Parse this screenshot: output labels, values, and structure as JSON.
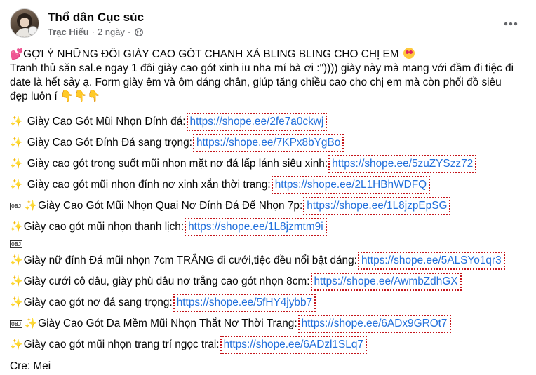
{
  "post": {
    "page_name": "Thổ dân Cục súc",
    "author": "Trạc Hiếu",
    "time": "2 ngày",
    "separator": "·",
    "more_icon": "more-horizontal-icon",
    "intro": {
      "heart_glyph": "💕",
      "headline": "GỢI Ý NHỮNG ĐÔI GIÀY CAO GÓT CHANH XẢ BLING BLING CHO CHỊ EM",
      "line2": "Tranh thủ săn sal.e ngay 1 đôi giày cao gót xinh iu nha mí bà ơi :\")))) giày này mà mang với đầm đi tiệc đi",
      "line3": "date là hết sảy ạ. Form giày êm và ôm dáng chân, giúp tăng chiều cao cho chị em mà còn phối đồ siêu",
      "line4": "đẹp luôn í",
      "hands": "👇👇👇"
    },
    "items": [
      {
        "prefix": "",
        "label": "Giày Cao Gót Mũi Nhọn Đính đá:",
        "link": "https://shope.ee/2fe7a0ckwj"
      },
      {
        "prefix": "",
        "label": "Giày Cao Gót Đính Đá sang trọng:",
        "link": "https://shope.ee/7KPx8bYgBo"
      },
      {
        "prefix": "",
        "label": "Giày cao gót trong suốt mũi nhọn mặt nơ đá lấp lánh siêu xinh:",
        "link": "https://shope.ee/5zuZYSzz72"
      },
      {
        "prefix": "",
        "label": "Giày cao gót mũi nhọn đính nơ xinh xắn thời trang:",
        "link": "https://shope.ee/2L1HBhWDFQ"
      },
      {
        "prefix": "OBJ",
        "label": "Giày Cao Gót Mũi Nhọn Quai Nơ Đính Đá Đế Nhọn 7p:",
        "link": "https://shope.ee/1L8jzpEpSG"
      },
      {
        "prefix": "",
        "label": "Giày cao gót mũi nhọn thanh lịch:",
        "link": "https://shope.ee/1L8jzmtm9i"
      },
      {
        "prefix": "",
        "label": "Giày nữ đính Đá mũi nhọn 7cm TRẮNG đi cưới,tiệc đều nổi bật dáng:",
        "link": "https://shope.ee/5ALSYo1qr3"
      },
      {
        "prefix": "",
        "label": "Giày cưới cô dâu, giày phù dâu nơ trắng cao gót nhọn 8cm:",
        "link": "https://shope.ee/AwmbZdhGX"
      },
      {
        "prefix": "",
        "label": "Giày cao gót nơ đá sang trọng:",
        "link": "https://shope.ee/5fHY4jybb7"
      },
      {
        "prefix": "OBJ",
        "label": "Giày Cao Gót Da Mềm Mũi Nhọn Thắt Nơ Thời Trang:",
        "link": "https://shope.ee/6ADx9GROt7"
      },
      {
        "prefix": "",
        "label": "Giày cao gót mũi nhọn trang trí ngọc trai:",
        "link": "https://shope.ee/6ADzl1SLq7"
      }
    ],
    "obj_marker": "OBJ",
    "sparkle_glyph": "✨",
    "credit": "Cre: Mei"
  },
  "colors": {
    "link": "#216fdb",
    "link_outline": "#c4161c",
    "meta_text": "#65676b"
  }
}
